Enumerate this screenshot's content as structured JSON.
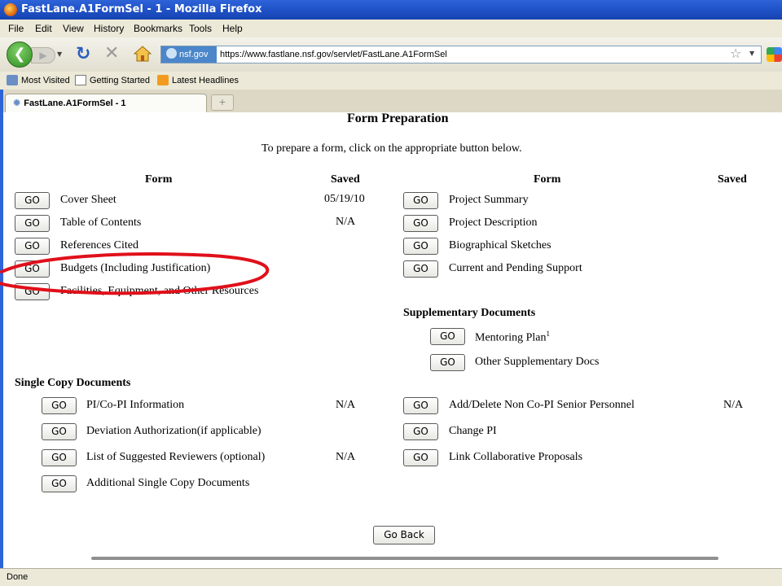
{
  "window": {
    "title": "FastLane.A1FormSel - 1 - Mozilla Firefox"
  },
  "menu": [
    "File",
    "Edit",
    "View",
    "History",
    "Bookmarks",
    "Tools",
    "Help"
  ],
  "address": {
    "site": "nsf.gov",
    "url": "https://www.fastlane.nsf.gov/servlet/FastLane.A1FormSel"
  },
  "bookmarks": [
    "Most Visited",
    "Getting Started",
    "Latest Headlines"
  ],
  "tab": {
    "label": "FastLane.A1FormSel - 1"
  },
  "page": {
    "heading": "Form Preparation",
    "instruction": "To prepare a form, click on the appropriate button below.",
    "go_label": "GO",
    "col_form": "Form",
    "col_saved": "Saved",
    "left_forms": [
      {
        "name": "Cover Sheet",
        "saved": "05/19/10"
      },
      {
        "name": "Table of Contents",
        "saved": "N/A"
      },
      {
        "name": "References Cited",
        "saved": ""
      },
      {
        "name": "Budgets (Including Justification)",
        "saved": ""
      },
      {
        "name": "Facilities, Equipment, and Other Resources",
        "saved": ""
      }
    ],
    "right_forms": [
      {
        "name": "Project Summary",
        "saved": ""
      },
      {
        "name": "Project Description",
        "saved": ""
      },
      {
        "name": "Biographical Sketches",
        "saved": ""
      },
      {
        "name": "Current and Pending Support",
        "saved": ""
      }
    ],
    "supplementary": {
      "heading": "Supplementary Documents",
      "items": [
        {
          "name": "Mentoring Plan",
          "sup": "1"
        },
        {
          "name": "Other Supplementary Docs",
          "sup": ""
        }
      ]
    },
    "single_copy": {
      "heading": "Single Copy Documents",
      "left": [
        {
          "name": "PI/Co-PI Information",
          "saved": "N/A"
        },
        {
          "name": "Deviation Authorization(if applicable)",
          "saved": ""
        },
        {
          "name": "List of Suggested Reviewers (optional)",
          "saved": "N/A"
        },
        {
          "name": "Additional Single Copy Documents",
          "saved": ""
        }
      ],
      "right": [
        {
          "name": "Add/Delete Non Co-PI Senior Personnel",
          "saved": "N/A"
        },
        {
          "name": "Change PI",
          "saved": ""
        },
        {
          "name": "Link Collaborative Proposals",
          "saved": ""
        }
      ]
    },
    "go_back_label": "Go Back"
  },
  "status": {
    "text": "Done"
  },
  "colors": {
    "title_bar": "#2e63d9",
    "annotation": "#e0101a"
  }
}
